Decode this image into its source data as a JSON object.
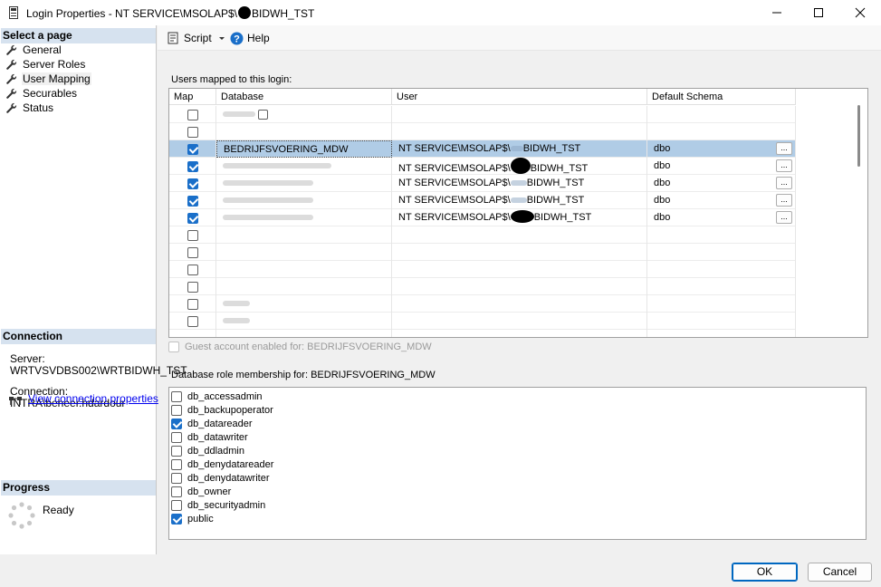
{
  "window": {
    "title_before": "Login Properties - NT SERVICE\\MSOLAP$\\",
    "title_after": "BIDWH_TST"
  },
  "left": {
    "select_page_header": "Select a page",
    "pages": [
      {
        "label": "General"
      },
      {
        "label": "Server Roles"
      },
      {
        "label": "User Mapping"
      },
      {
        "label": "Securables"
      },
      {
        "label": "Status"
      }
    ],
    "connection_header": "Connection",
    "server_label": "Server:",
    "server_value": "WRTVSVDBS002\\WRTBIDWH_TST",
    "connection_label": "Connection:",
    "connection_value": "INTRA\\beheer.hdardour",
    "view_connection_link": "View connection properties",
    "progress_header": "Progress",
    "progress_status": "Ready"
  },
  "toolbar": {
    "script_label": "Script",
    "help_label": "Help"
  },
  "mapping": {
    "label": "Users mapped to this login:",
    "columns": {
      "map": "Map",
      "database": "Database",
      "user": "User",
      "schema": "Default Schema"
    },
    "selected_database": "BEDRIJFSVOERING_MDW",
    "user_prefix": "NT SERVICE\\MSOLAP$\\",
    "user_suffix": "BIDWH_TST",
    "schema": "dbo",
    "ellipsis": "..."
  },
  "guest_label": "Guest account enabled for: BEDRIJFSVOERING_MDW",
  "roles": {
    "label": "Database role membership for: BEDRIJFSVOERING_MDW",
    "items": [
      {
        "name": "db_accessadmin",
        "checked": false
      },
      {
        "name": "db_backupoperator",
        "checked": false
      },
      {
        "name": "db_datareader",
        "checked": true
      },
      {
        "name": "db_datawriter",
        "checked": false
      },
      {
        "name": "db_ddladmin",
        "checked": false
      },
      {
        "name": "db_denydatareader",
        "checked": false
      },
      {
        "name": "db_denydatawriter",
        "checked": false
      },
      {
        "name": "db_owner",
        "checked": false
      },
      {
        "name": "db_securityadmin",
        "checked": false
      },
      {
        "name": "public",
        "checked": true
      }
    ]
  },
  "buttons": {
    "ok": "OK",
    "cancel": "Cancel"
  },
  "colors": {
    "accent": "#1a6fc9",
    "selected_row": "#b0cce6",
    "section_header": "#d6e2ef"
  }
}
